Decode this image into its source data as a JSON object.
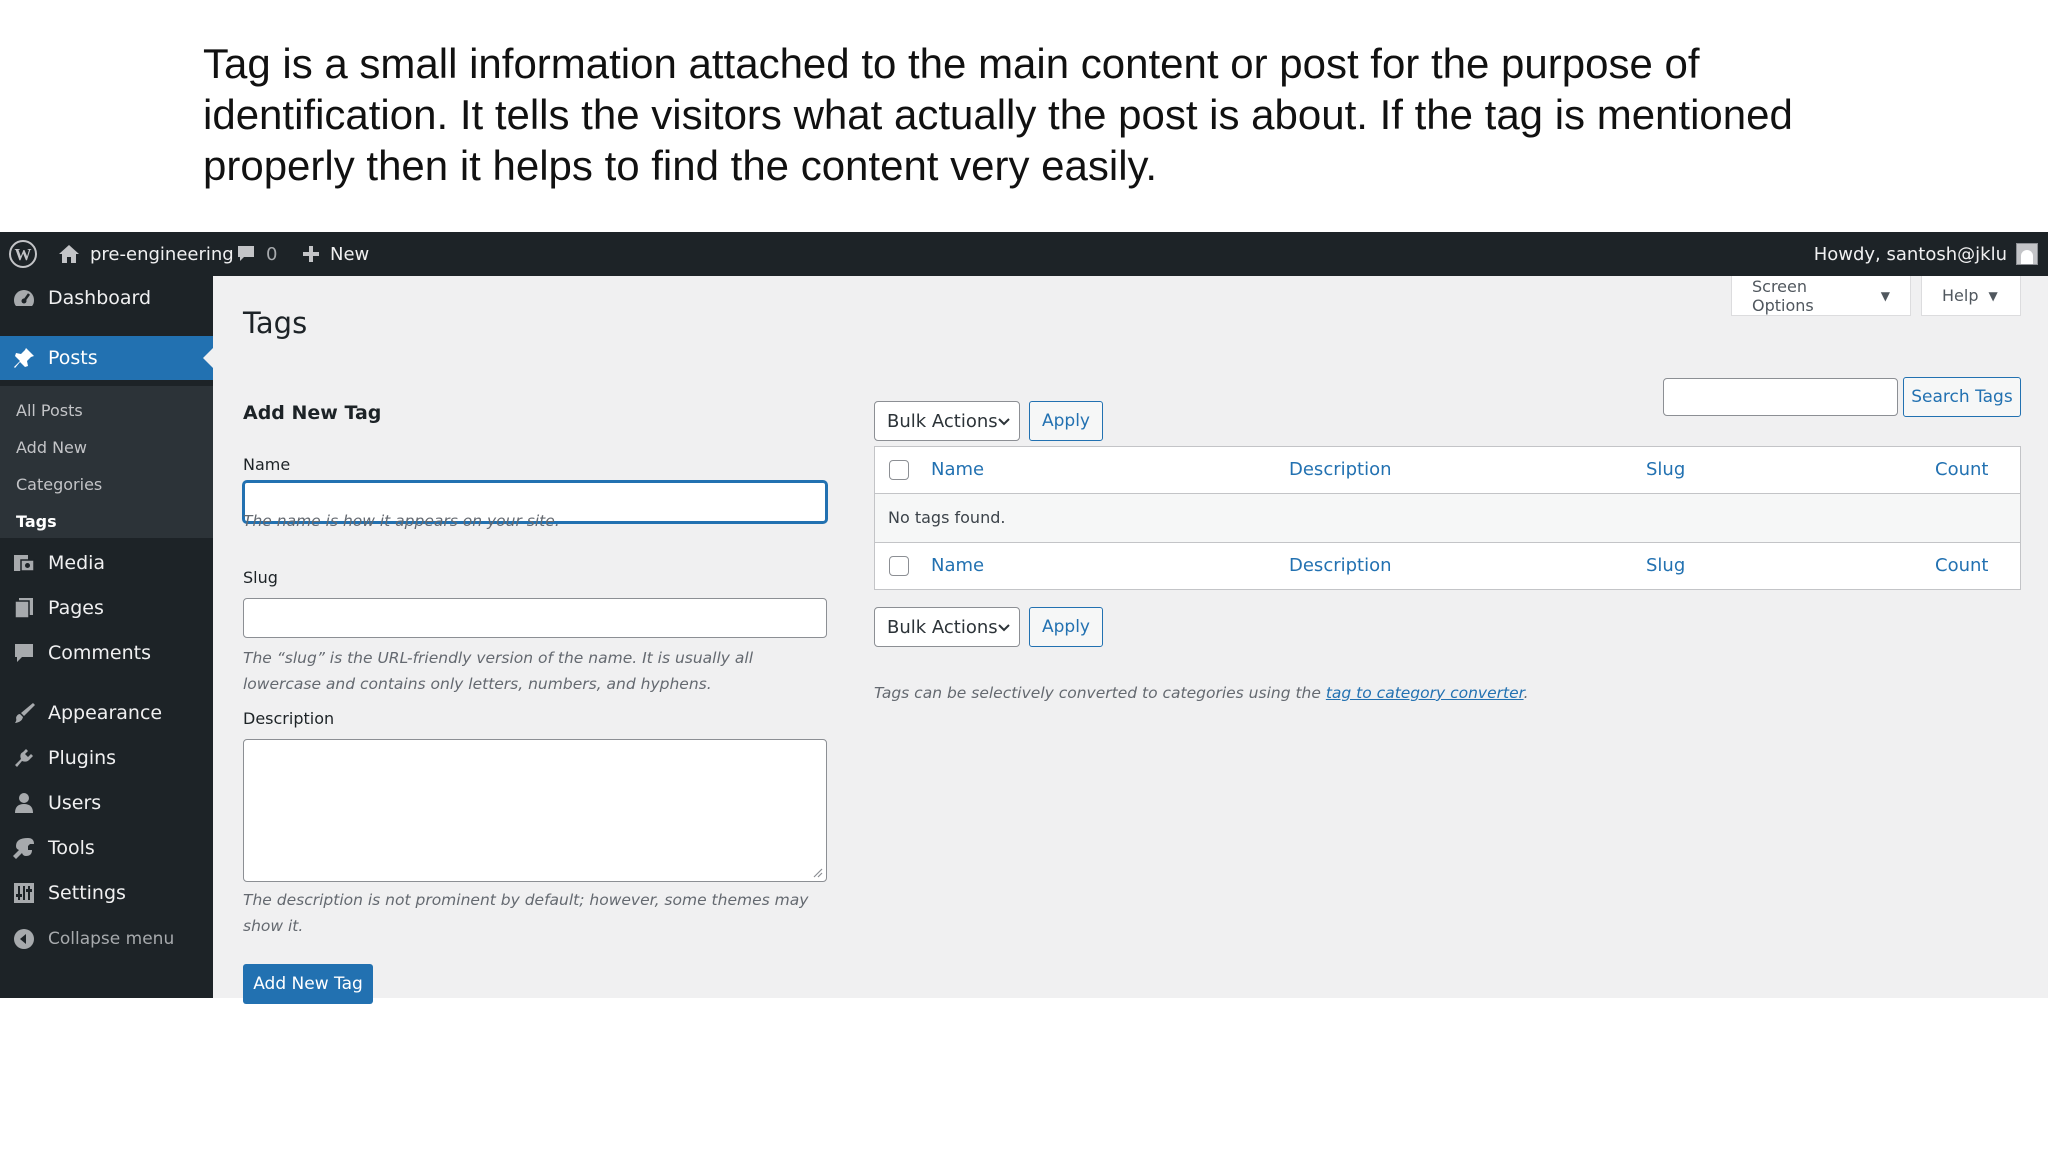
{
  "caption": "Tag is a small information attached to the main content or post for the purpose of identification. It tells the visitors what actually the post is about. If the tag is mentioned properly then it helps to find the content very easily.",
  "adminbar": {
    "site_name": "pre-engineering",
    "comments_count": "0",
    "new_label": "New",
    "howdy": "Howdy, santosh@jklu"
  },
  "sidebar": {
    "dashboard": "Dashboard",
    "posts": "Posts",
    "submenu": [
      "All Posts",
      "Add New",
      "Categories",
      "Tags"
    ],
    "media": "Media",
    "pages": "Pages",
    "comments": "Comments",
    "appearance": "Appearance",
    "plugins": "Plugins",
    "users": "Users",
    "tools": "Tools",
    "settings": "Settings",
    "collapse": "Collapse menu",
    "accent_color": "#2271b1"
  },
  "header": {
    "title": "Tags",
    "screen_options": "Screen Options",
    "help": "Help",
    "search_button": "Search Tags",
    "search_value": ""
  },
  "form": {
    "heading": "Add New Tag",
    "name_label": "Name",
    "name_value": "",
    "name_help": "The name is how it appears on your site.",
    "slug_label": "Slug",
    "slug_value": "",
    "slug_help": "The “slug” is the URL-friendly version of the name. It is usually all lowercase and contains only letters, numbers, and hyphens.",
    "description_label": "Description",
    "description_value": "",
    "description_help": "The description is not prominent by default; however, some themes may show it.",
    "submit": "Add New Tag"
  },
  "table": {
    "bulk_actions": "Bulk Actions",
    "apply": "Apply",
    "columns": [
      "Name",
      "Description",
      "Slug",
      "Count"
    ],
    "empty": "No tags found.",
    "note_prefix": "Tags can be selectively converted to categories using the ",
    "note_link": "tag to category converter",
    "note_suffix": "."
  }
}
